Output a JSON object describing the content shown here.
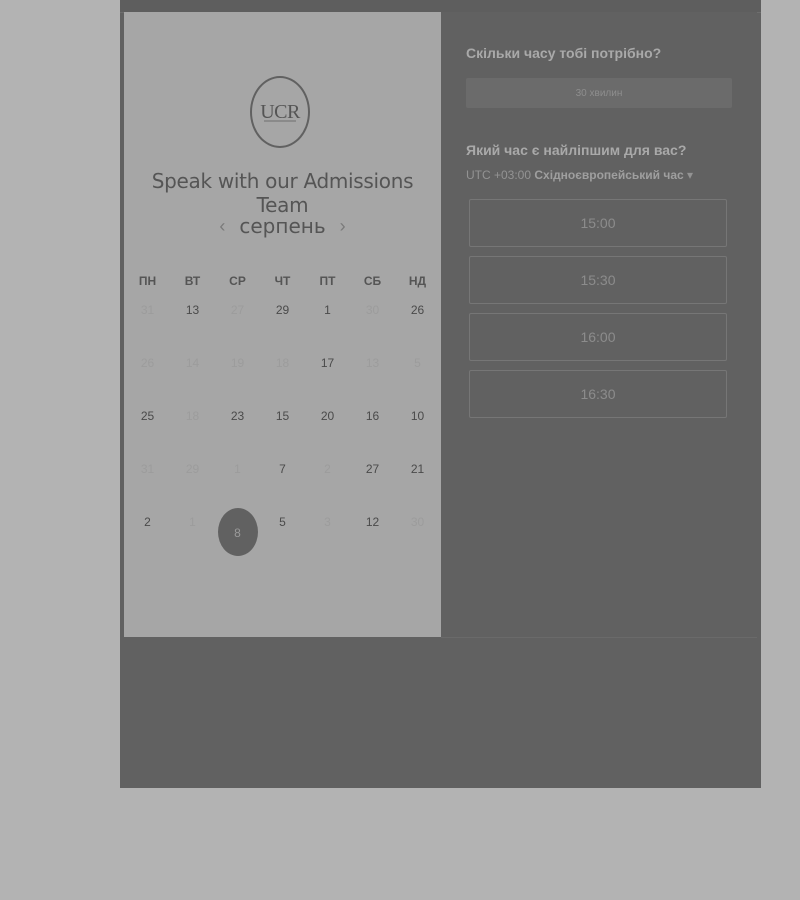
{
  "brand": {
    "logo_text": "UCR",
    "title": "Speak with our Admissions Team"
  },
  "calendar": {
    "month": "серпень",
    "prev_icon": "chevron-left-icon",
    "next_icon": "chevron-right-icon",
    "weekdays": [
      "ПН",
      "ВТ",
      "СР",
      "ЧТ",
      "ПТ",
      "СБ",
      "НД"
    ],
    "days": [
      {
        "label": "31",
        "available": false
      },
      {
        "label": "13",
        "available": true
      },
      {
        "label": "27",
        "available": false
      },
      {
        "label": "29",
        "available": true
      },
      {
        "label": "1",
        "available": true
      },
      {
        "label": "30",
        "available": false
      },
      {
        "label": "26",
        "available": true
      },
      {
        "label": "26",
        "available": false
      },
      {
        "label": "14",
        "available": false
      },
      {
        "label": "19",
        "available": false
      },
      {
        "label": "18",
        "available": false
      },
      {
        "label": "17",
        "available": true
      },
      {
        "label": "13",
        "available": false
      },
      {
        "label": "5",
        "available": false
      },
      {
        "label": "25",
        "available": true
      },
      {
        "label": "18",
        "available": false
      },
      {
        "label": "23",
        "available": true
      },
      {
        "label": "15",
        "available": true
      },
      {
        "label": "20",
        "available": true
      },
      {
        "label": "16",
        "available": true
      },
      {
        "label": "10",
        "available": true
      },
      {
        "label": "31",
        "available": false
      },
      {
        "label": "29",
        "available": false
      },
      {
        "label": "1",
        "available": false
      },
      {
        "label": "7",
        "available": true
      },
      {
        "label": "2",
        "available": false
      },
      {
        "label": "27",
        "available": true
      },
      {
        "label": "21",
        "available": true
      },
      {
        "label": "2",
        "available": true
      },
      {
        "label": "1",
        "available": false
      },
      {
        "label": "8",
        "available": true,
        "selected": true
      },
      {
        "label": "5",
        "available": true
      },
      {
        "label": "3",
        "available": false
      },
      {
        "label": "12",
        "available": true
      },
      {
        "label": "30",
        "available": false
      }
    ]
  },
  "scheduler": {
    "duration_question": "Скільки часу тобі потрібно?",
    "duration_value": "30 хвилин",
    "time_question": "Який час є найліпшим для вас?",
    "timezone_offset": "UTC +03:00",
    "timezone_name": "Східноєвропейський час",
    "timezone_caret": "▾",
    "slots": [
      "15:00",
      "15:30",
      "16:00",
      "16:30"
    ]
  }
}
